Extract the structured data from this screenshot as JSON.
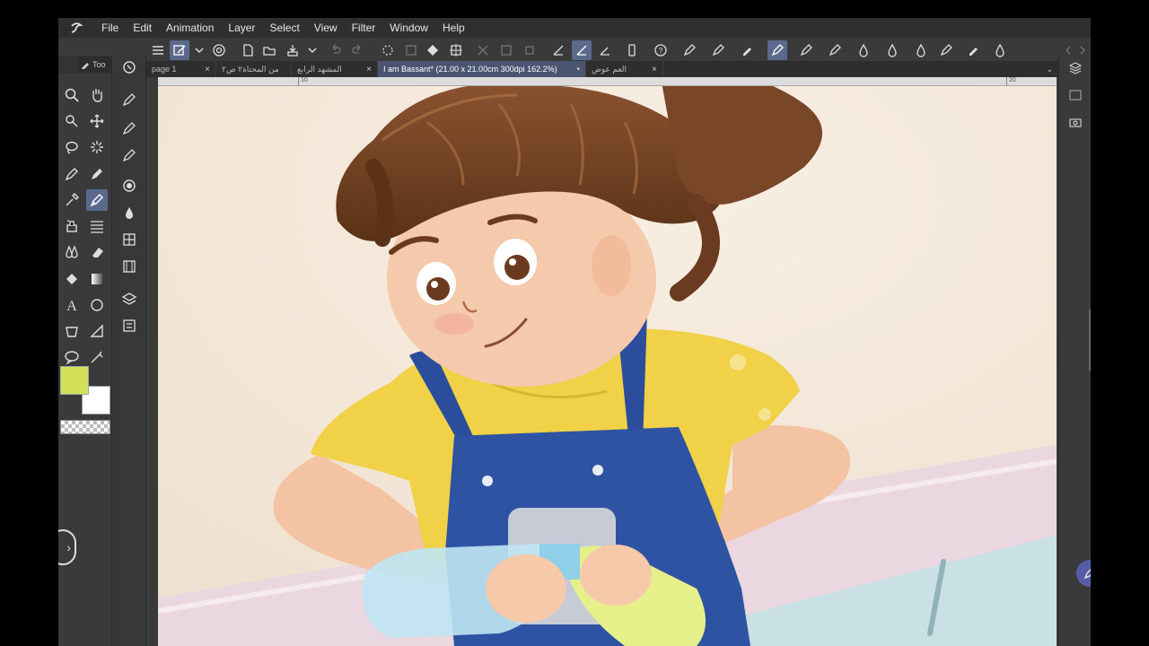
{
  "menu": [
    "File",
    "Edit",
    "Animation",
    "Layer",
    "Select",
    "View",
    "Filter",
    "Window",
    "Help"
  ],
  "tool_palette": {
    "tab_label": "Too"
  },
  "tabs": [
    {
      "label": "page 1",
      "active": false
    },
    {
      "label": "من المحتاة٢ ص٢",
      "active": false
    },
    {
      "label": "المشهد الرابع",
      "active": false
    },
    {
      "label": "I am Bassant* (21.00 x 21.00cm 300dpi 162.2%)",
      "active": true
    },
    {
      "label": "العم عوض",
      "active": false
    }
  ],
  "ruler": {
    "ticks": [
      "10",
      "20"
    ]
  },
  "colors": {
    "main": "#d3e05a",
    "sub": "#ffffff",
    "accent": "#5b6a8c"
  }
}
